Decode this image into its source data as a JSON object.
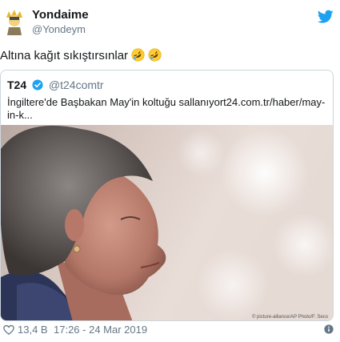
{
  "tweet": {
    "display_name": "Yondaime",
    "handle": "@Yondeym",
    "text": "Altına kağıt sıkıştırsınlar",
    "emoji": [
      "rolling-on-floor-laughing",
      "rolling-on-floor-laughing"
    ]
  },
  "quote": {
    "name": "T24",
    "handle": "@t24comtr",
    "text": "İngiltere'de Başbakan May'in koltuğu sallanıyort24.com.tr/haber/may-in-k...",
    "photo_credit": "© picture-alliance/AP Photo/F. Seco"
  },
  "footer": {
    "likes": "13,4 B",
    "timestamp": "17:26 - 24 Mar 2019"
  },
  "colors": {
    "accent": "#1da1f2",
    "muted": "#657786",
    "border": "#ccd6dd"
  }
}
